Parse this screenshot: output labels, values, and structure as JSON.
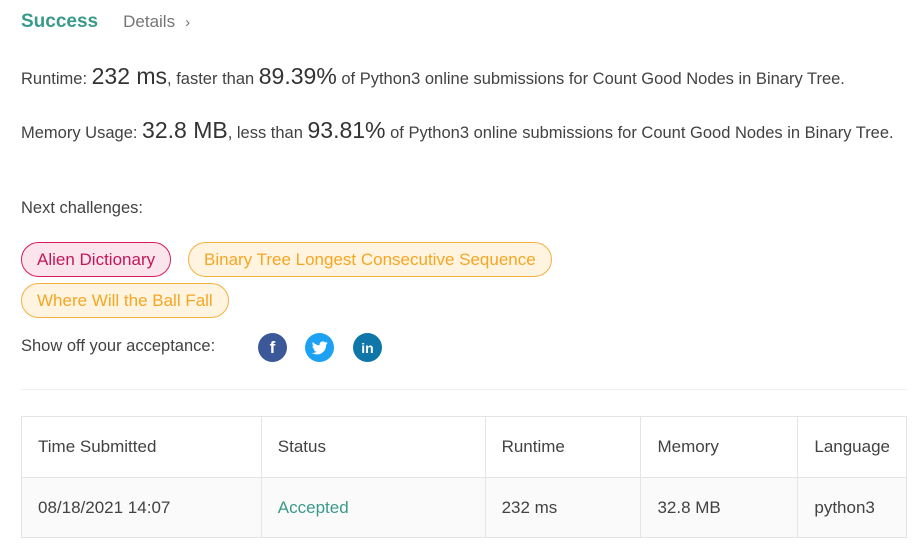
{
  "header": {
    "status": "Success",
    "details_label": "Details",
    "details_chevron": "›"
  },
  "runtime": {
    "label": "Runtime: ",
    "value": "232 ms",
    "mid": ", faster than ",
    "percent": "89.39%",
    "suffix": " of Python3 online submissions for Count Good Nodes in Binary Tree."
  },
  "memory": {
    "label": "Memory Usage: ",
    "value": "32.8 MB",
    "mid": ", less than ",
    "percent": "93.81%",
    "suffix": " of Python3 online submissions for Count Good Nodes in Binary Tree."
  },
  "next_challenges": {
    "label": "Next challenges:",
    "items": [
      {
        "title": "Alien Dictionary",
        "difficulty": "hard"
      },
      {
        "title": "Binary Tree Longest Consecutive Sequence",
        "difficulty": "medium"
      },
      {
        "title": "Where Will the Ball Fall",
        "difficulty": "medium"
      }
    ]
  },
  "share": {
    "label": "Show off your acceptance:",
    "icons": [
      "facebook-icon",
      "twitter-icon",
      "linkedin-icon"
    ],
    "colors": {
      "facebook": "#3b5998",
      "twitter": "#1da1f2",
      "linkedin": "#0e76a8"
    }
  },
  "table": {
    "headers": [
      "Time Submitted",
      "Status",
      "Runtime",
      "Memory",
      "Language"
    ],
    "rows": [
      [
        "08/18/2021 14:07",
        "Accepted",
        "232 ms",
        "32.8 MB",
        "python3"
      ]
    ]
  },
  "colors": {
    "accent": "#3a9a8a",
    "hard": "#c2185b",
    "medium": "#f5a623"
  }
}
